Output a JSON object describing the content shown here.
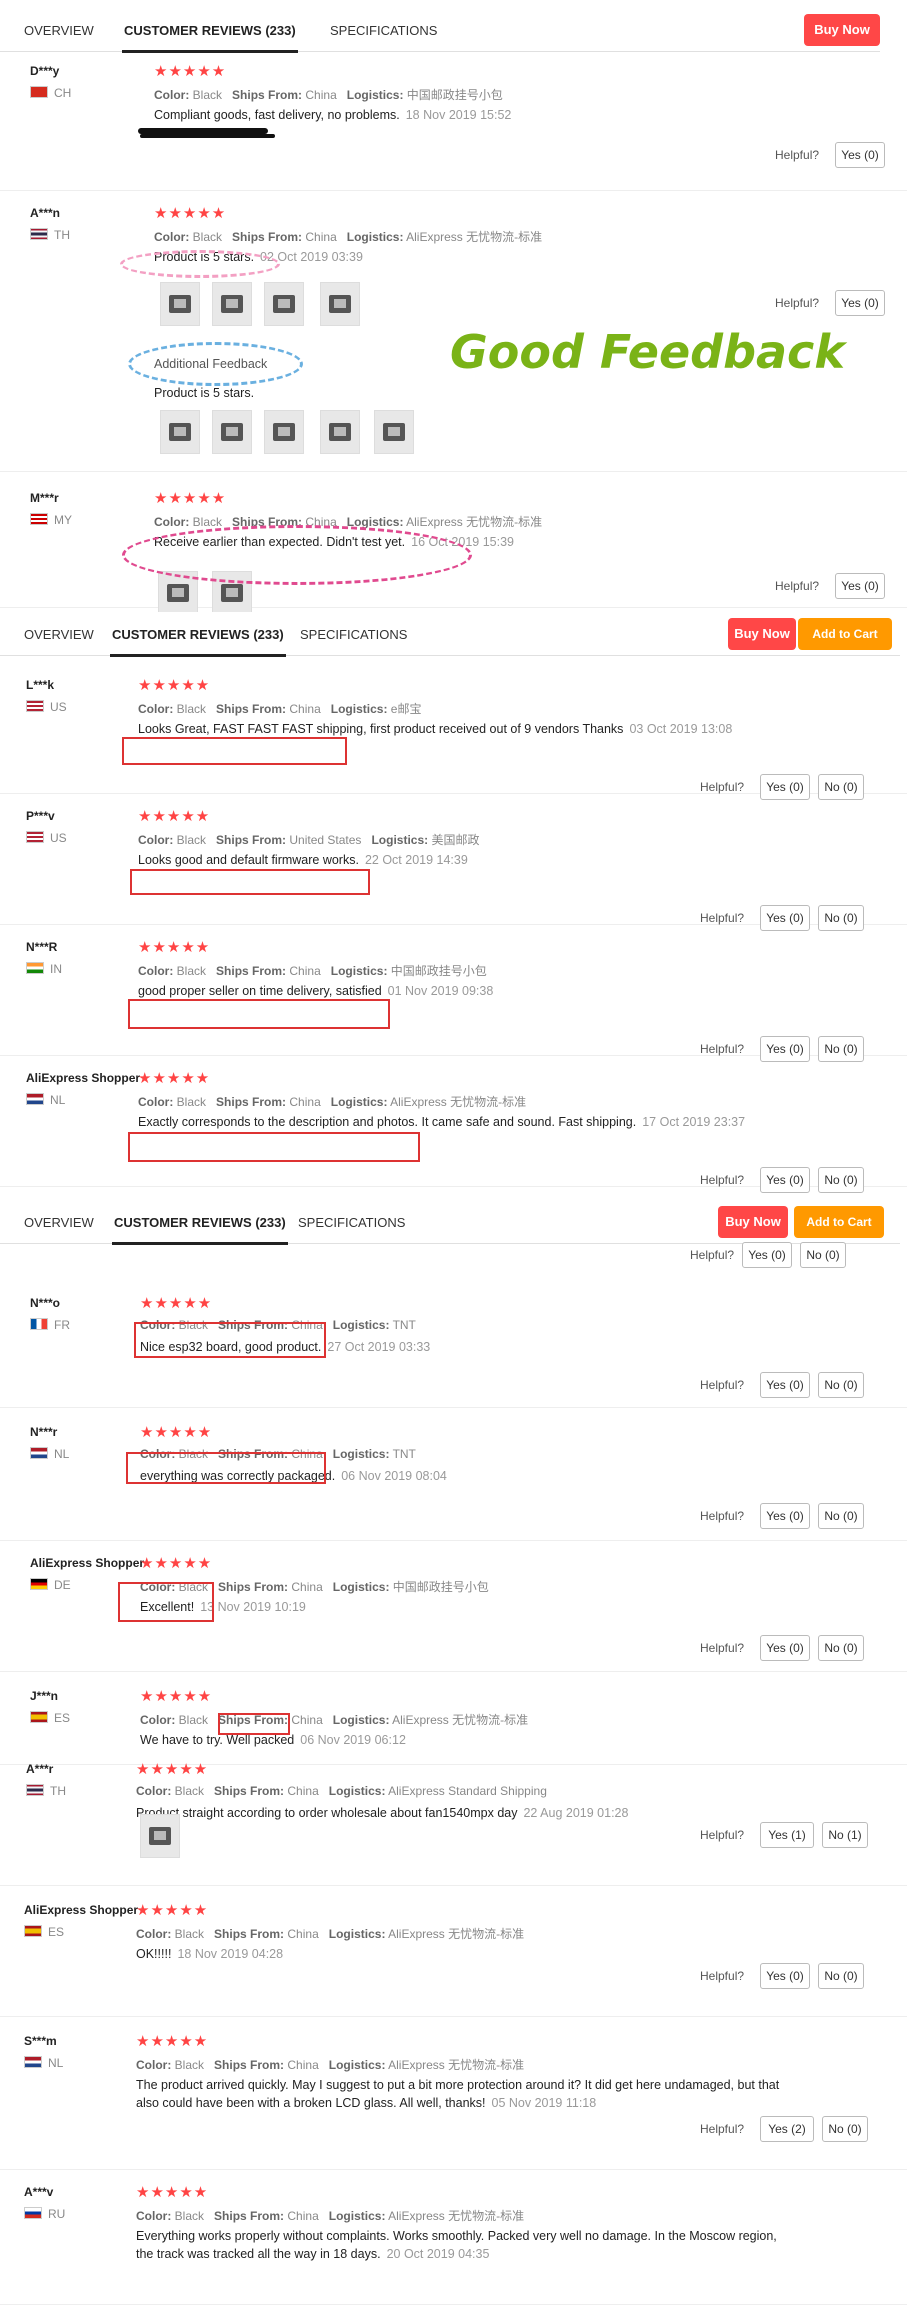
{
  "tabs": {
    "overview": "OVERVIEW",
    "reviews": "CUSTOMER REVIEWS (233)",
    "specs": "SPECIFICATIONS",
    "buy": "Buy Now",
    "cart": "Add to Cart"
  },
  "labels": {
    "color": "Color:",
    "ships": "Ships From:",
    "logistics": "Logistics:",
    "helpful": "Helpful?",
    "additional": "Additional Feedback",
    "good_feedback": "Good Feedback"
  },
  "reviews": [
    {
      "user": "D***y",
      "country": "CH",
      "color": "Black",
      "ships": "China",
      "logistics": "中国邮政挂号小包",
      "text": "Compliant goods, fast delivery, no problems.",
      "date": "18 Nov 2019 15:52",
      "yes": "Yes (0)",
      "no": ""
    },
    {
      "user": "A***n",
      "country": "TH",
      "color": "Black",
      "ships": "China",
      "logistics": "AliExpress 无忧物流-标准",
      "text": "Product is 5 stars.",
      "date": "02 Oct 2019 03:39",
      "additional": "Product is 5 stars.",
      "yes": "Yes (0)",
      "no": ""
    },
    {
      "user": "M***r",
      "country": "MY",
      "color": "Black",
      "ships": "China",
      "logistics": "AliExpress 无忧物流-标准",
      "text": "Receive earlier than expected. Didn't test yet.",
      "date": "16 Oct 2019 15:39",
      "yes": "Yes (0)",
      "no": ""
    },
    {
      "user": "L***k",
      "country": "US",
      "color": "Black",
      "ships": "China",
      "logistics": "e邮宝",
      "text": "Looks Great, FAST FAST FAST shipping, first product received out of 9 vendors Thanks",
      "date": "03 Oct 2019 13:08",
      "yes": "Yes (0)",
      "no": "No (0)"
    },
    {
      "user": "P***v",
      "country": "US",
      "color": "Black",
      "ships": "United States",
      "logistics": "美国邮政",
      "text": "Looks good and default firmware works.",
      "date": "22 Oct 2019 14:39",
      "yes": "Yes (0)",
      "no": "No (0)"
    },
    {
      "user": "N***R",
      "country": "IN",
      "color": "Black",
      "ships": "China",
      "logistics": "中国邮政挂号小包",
      "text": "good proper seller on time delivery, satisfied",
      "date": "01 Nov 2019 09:38",
      "yes": "Yes (0)",
      "no": "No (0)"
    },
    {
      "user": "AliExpress Shopper",
      "country": "NL",
      "color": "Black",
      "ships": "China",
      "logistics": "AliExpress 无忧物流-标准",
      "text": "Exactly corresponds to the description and photos. It came safe and sound. Fast shipping.",
      "date": "17 Oct 2019 23:37",
      "yes": "Yes (0)",
      "no": "No (0)"
    },
    {
      "user": "N***o",
      "country": "FR",
      "color": "Black",
      "ships": "China",
      "logistics": "TNT",
      "text": "Nice esp32 board, good product.",
      "date": "27 Oct 2019 03:33",
      "yes": "Yes (0)",
      "no": "No (0)"
    },
    {
      "user": "N***r",
      "country": "NL",
      "color": "Black",
      "ships": "China",
      "logistics": "TNT",
      "text": "everything was correctly packaged.",
      "date": "06 Nov 2019 08:04",
      "yes": "Yes (0)",
      "no": "No (0)"
    },
    {
      "user": "AliExpress Shopper",
      "country": "DE",
      "color": "Black",
      "ships": "China",
      "logistics": "中国邮政挂号小包",
      "text": "Excellent!",
      "date": "13 Nov 2019 10:19",
      "yes": "Yes (0)",
      "no": "No (0)"
    },
    {
      "user": "J***n",
      "country": "ES",
      "color": "Black",
      "ships": "China",
      "logistics": "AliExpress 无忧物流-标准",
      "text": "We have to try. Well packed",
      "date": "06 Nov 2019 06:12",
      "yes": "",
      "no": ""
    },
    {
      "user": "A***r",
      "country": "TH",
      "color": "Black",
      "ships": "China",
      "logistics": "AliExpress Standard Shipping",
      "text": "Product straight according to order wholesale about fan1540mpx day",
      "date": "22 Aug 2019 01:28",
      "yes": "Yes (1)",
      "no": "No (1)"
    },
    {
      "user": "AliExpress Shopper",
      "country": "ES",
      "color": "Black",
      "ships": "China",
      "logistics": "AliExpress 无忧物流-标准",
      "text": "OK!!!!!",
      "date": "18 Nov 2019 04:28",
      "yes": "Yes (0)",
      "no": "No (0)"
    },
    {
      "user": "S***m",
      "country": "NL",
      "color": "Black",
      "ships": "China",
      "logistics": "AliExpress 无忧物流-标准",
      "text": "The product arrived quickly. May I suggest to put a bit more protection around it? It did get here undamaged, but that also could have been with a broken LCD glass. All well, thanks!",
      "date": "05 Nov 2019 11:18",
      "yes": "Yes (2)",
      "no": "No (0)"
    },
    {
      "user": "A***v",
      "country": "RU",
      "color": "Black",
      "ships": "China",
      "logistics": "AliExpress 无忧物流-标准",
      "text": "Everything works properly without complaints. Works smoothly. Packed very well no damage. In the Moscow region, the track was tracked all the way in 18 days.",
      "date": "20 Oct 2019 04:35",
      "yes": "",
      "no": ""
    }
  ],
  "colors": {
    "buy": "#ff4747",
    "cart": "#ff9900",
    "stars": "#ff4444",
    "good_feedback": "#7ab317",
    "annotation_red": "#d33333",
    "annotation_pink": "#e04a8f",
    "annotation_blue": "#6ab0e0"
  }
}
